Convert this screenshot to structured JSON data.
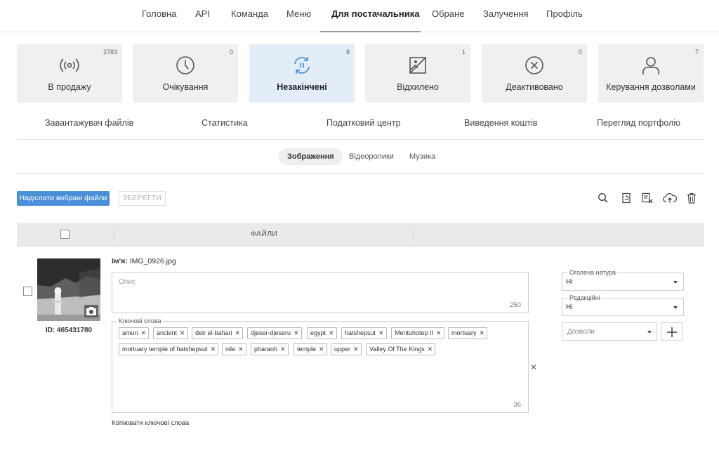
{
  "nav": {
    "items": [
      "Головна",
      "API",
      "Команда",
      "Меню",
      "Для постачальника",
      "Обране",
      "Залучення",
      "Профіль"
    ],
    "active": "Для постачальника"
  },
  "cards": [
    {
      "label": "В продажу",
      "count": "2783",
      "icon": "broadcast-icon"
    },
    {
      "label": "Очікування",
      "count": "0",
      "icon": "clock-icon"
    },
    {
      "label": "Незакінчені",
      "count": "8",
      "icon": "sync-pause-icon",
      "active": true
    },
    {
      "label": "Відхилено",
      "count": "1",
      "icon": "image-rejected-icon"
    },
    {
      "label": "Деактивовано",
      "count": "0",
      "icon": "circle-x-icon"
    },
    {
      "label": "Керування дозволами",
      "count": "7",
      "icon": "person-icon"
    }
  ],
  "links": [
    "Завантажувач файлів",
    "Статистика",
    "Податковий центр",
    "Виведення коштів",
    "Перегляд портфоліо"
  ],
  "media_tabs": [
    "Зображення",
    "Відеоролики",
    "Музика"
  ],
  "toolbar": {
    "submit_label": "Надіслати вибрані файли",
    "save_label": "ЗБЕРЕГТИ",
    "submit_color": "#4a90d9",
    "icons": [
      "search-icon",
      "refresh-doc-icon",
      "clear-list-icon",
      "upload-cloud-icon",
      "trash-icon"
    ]
  },
  "table": {
    "files_header": "ФАЙЛИ"
  },
  "file": {
    "name_label": "Ім'я:",
    "name_value": "IMG_0926.jpg",
    "id_text": "ID: 465431780",
    "description_placeholder": "Опис",
    "description_count": "250",
    "keywords_label": "Ключові слова",
    "keywords_count": "36",
    "keywords": [
      "amun",
      "ancient",
      "deir el-bahari",
      "djeser-djeseru",
      "egypt",
      "hatshepsut",
      "Mentuhotep II",
      "mortuary",
      "mortuary temple of hatshepsut",
      "nile",
      "pharaoh",
      "temple",
      "upper",
      "Valley Of The Kings"
    ],
    "copy_keywords": "Копіювати ключові слова"
  },
  "options": {
    "nudity_label": "Оголена натура",
    "nudity_value": "Ні",
    "editorial_label": "Редакційні",
    "editorial_value": "Ні",
    "permissions_placeholder": "Дозволи"
  }
}
